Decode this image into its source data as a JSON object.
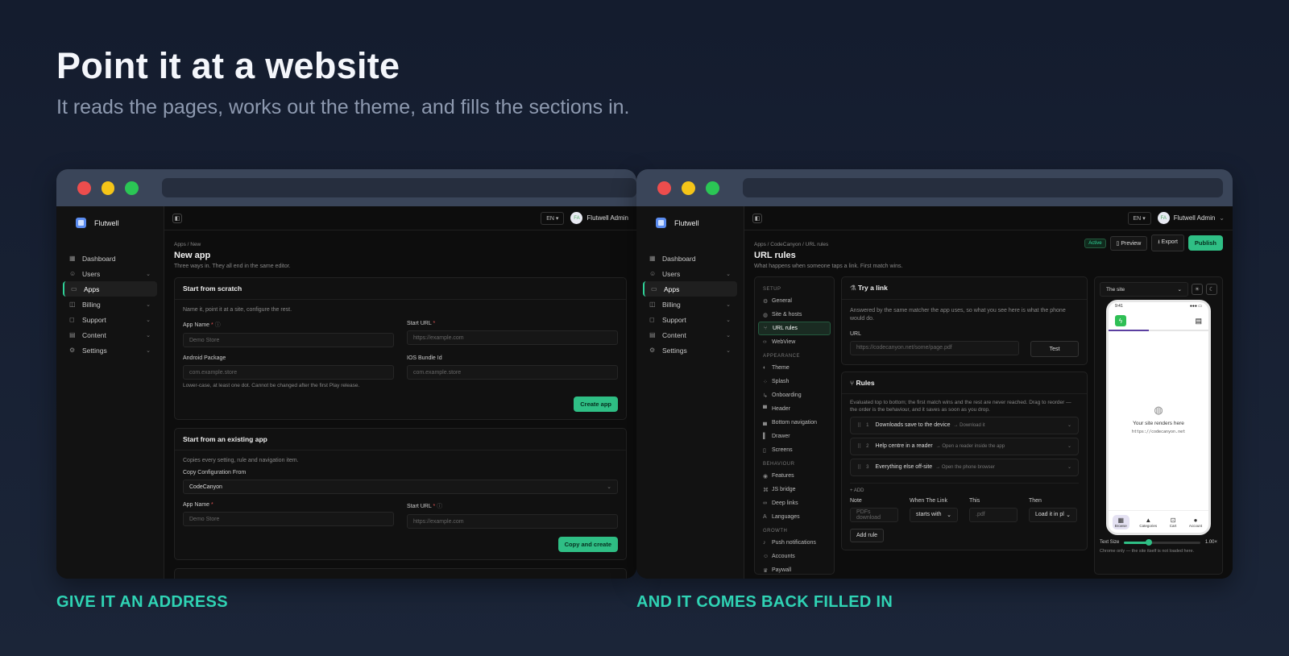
{
  "hero": {
    "title": "Point it at a website",
    "subtitle": "It reads the pages, works out the theme, and fills the sections in."
  },
  "captions": {
    "left": "GIVE IT AN ADDRESS",
    "right": "AND IT COMES BACK FILLED IN"
  },
  "brand": "Flutwell",
  "nav": [
    {
      "label": "Dashboard",
      "icon": "dashboard-icon",
      "chev": false
    },
    {
      "label": "Users",
      "icon": "user-icon",
      "chev": true
    },
    {
      "label": "Apps",
      "icon": "apps-icon",
      "chev": false,
      "active": true
    },
    {
      "label": "Billing",
      "icon": "billing-icon",
      "chev": true
    },
    {
      "label": "Support",
      "icon": "support-icon",
      "chev": true
    },
    {
      "label": "Content",
      "icon": "content-icon",
      "chev": true
    },
    {
      "label": "Settings",
      "icon": "gear-icon",
      "chev": true
    }
  ],
  "topbar": {
    "lang": "EN",
    "user": "Flutwell Admin",
    "avatar": "FA"
  },
  "left": {
    "crumb_root": "Apps",
    "crumb_leaf": "New",
    "title": "New app",
    "desc": "Three ways in. They all end in the same editor.",
    "scratch": {
      "title": "Start from scratch",
      "desc": "Name it, point it at a site, configure the rest.",
      "app_name": "App Name",
      "app_name_ph": "Demo Store",
      "start_url": "Start URL",
      "start_url_ph": "https://example.com",
      "android": "Android Package",
      "android_ph": "com.example.store",
      "ios": "IOS Bundle Id",
      "ios_ph": "com.example.store",
      "hint": "Lower-case, at least one dot. Cannot be changed after the first Play release.",
      "button": "Create app"
    },
    "existing": {
      "title": "Start from an existing app",
      "desc": "Copies every setting, rule and navigation item.",
      "copy_label": "Copy Configuration From",
      "copy_value": "CodeCanyon",
      "app_name": "App Name",
      "app_name_ph": "Demo Store",
      "start_url": "Start URL",
      "start_url_ph": "https://example.com",
      "button": "Copy and create"
    }
  },
  "right": {
    "crumb_root": "Apps",
    "crumb_mid": "CodeCanyon",
    "crumb_leaf": "URL rules",
    "title": "URL rules",
    "desc": "What happens when someone taps a link. First match wins.",
    "status": "Active",
    "preview": "Preview",
    "export": "Export",
    "publish": "Publish",
    "subnav": [
      {
        "header": "SETUP",
        "items": [
          {
            "label": "General",
            "icon": "gear-icon"
          },
          {
            "label": "Site & hosts",
            "icon": "globe-icon"
          },
          {
            "label": "URL rules",
            "icon": "branch-icon",
            "active": true
          },
          {
            "label": "WebView",
            "icon": "code-icon"
          }
        ]
      },
      {
        "header": "APPEARANCE",
        "items": [
          {
            "label": "Theme",
            "icon": "palette-icon"
          },
          {
            "label": "Splash",
            "icon": "splash-icon"
          },
          {
            "label": "Onboarding",
            "icon": "onboarding-icon"
          },
          {
            "label": "Header",
            "icon": "header-icon"
          },
          {
            "label": "Bottom navigation",
            "icon": "bottom-nav-icon"
          },
          {
            "label": "Drawer",
            "icon": "drawer-icon"
          },
          {
            "label": "Screens",
            "icon": "screens-icon"
          }
        ]
      },
      {
        "header": "BEHAVIOUR",
        "items": [
          {
            "label": "Features",
            "icon": "toggle-icon"
          },
          {
            "label": "JS bridge",
            "icon": "bridge-icon"
          },
          {
            "label": "Deep links",
            "icon": "link-icon"
          },
          {
            "label": "Languages",
            "icon": "language-icon"
          }
        ]
      },
      {
        "header": "GROWTH",
        "items": [
          {
            "label": "Push notifications",
            "icon": "bell-icon"
          },
          {
            "label": "Accounts",
            "icon": "accounts-icon"
          },
          {
            "label": "Paywall",
            "icon": "crown-icon"
          }
        ]
      }
    ],
    "try": {
      "title": "Try a link",
      "desc": "Answered by the same matcher the app uses, so what you see here is what the phone would do.",
      "url_label": "URL",
      "url_ph": "https://codecanyon.net/some/page.pdf",
      "test": "Test"
    },
    "rules": {
      "title": "Rules",
      "desc": "Evaluated top to bottom; the first match wins and the rest are never reached. Drag to reorder — the order is the behaviour, and it saves as soon as you drop.",
      "items": [
        {
          "n": "1",
          "label": "Downloads save to the device",
          "sub": "→ Download it"
        },
        {
          "n": "2",
          "label": "Help centre in a reader",
          "sub": "→ Open a reader inside the app"
        },
        {
          "n": "3",
          "label": "Everything else off-site",
          "sub": "→ Open the phone browser"
        }
      ],
      "add": "+ ADD",
      "note": "Note",
      "note_ph": "PDFs download",
      "when": "When The Link",
      "when_val": "starts with",
      "this": "This",
      "this_ph": ".pdf",
      "then": "Then",
      "then_val": "Load it in pl",
      "add_rule": "Add rule"
    },
    "preview_panel": {
      "select": "The site",
      "time": "9:41",
      "renders": "Your site renders here",
      "url": "https://codecanyon.net",
      "tabs": [
        {
          "label": "Browse",
          "icon": "browse-icon"
        },
        {
          "label": "Categories",
          "icon": "categories-icon"
        },
        {
          "label": "Cart",
          "icon": "cart-icon"
        },
        {
          "label": "Account",
          "icon": "account-icon"
        }
      ],
      "text_size": "Text Size",
      "text_size_val": "1.00×",
      "text_size_level": 0.32,
      "note": "Chrome only — the site itself is not loaded here."
    }
  }
}
